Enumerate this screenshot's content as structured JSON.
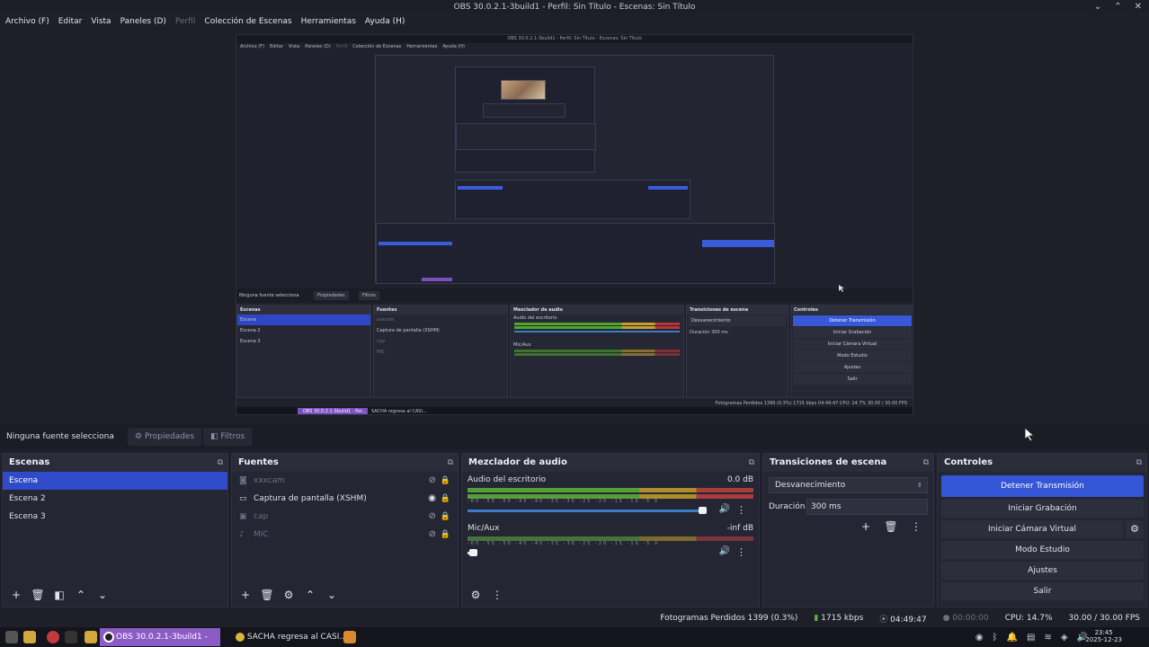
{
  "window": {
    "title": "OBS 30.0.2.1-3build1 - Perfil: Sin Título - Escenas: Sin Título",
    "controls": [
      "⌄",
      "⌃",
      "✕"
    ]
  },
  "menu": [
    "Archivo (F)",
    "Editar",
    "Vista",
    "Paneles (D)",
    "Perfil",
    "Colección de Escenas",
    "Herramientas",
    "Ayuda (H)"
  ],
  "preview": {
    "nested_title": "OBS 30.0.2.1-3build1 - Perfil: Sin Título - Escenas: Sin Título",
    "nested_menu": [
      "Archivo (F)",
      "Editar",
      "Vista",
      "Paneles (D)",
      "Perfil",
      "Colección de Escenas",
      "Herramientas",
      "Ayuda (H)"
    ],
    "nested_source_label": "Ninguna fuente selecciona",
    "nested_tabs": [
      "Propiedades",
      "Filtros"
    ],
    "nested_heads": [
      "Escenas",
      "Fuentes",
      "Mezclador de audio",
      "Transiciones de escena",
      "Controles"
    ],
    "nested_scenes": [
      "Escena",
      "Escena 2",
      "Escena 3"
    ],
    "nested_sources": [
      "xxxcam",
      "Captura de pantalla (XSHM)",
      "cap",
      "MIC"
    ],
    "nested_audio": [
      "Audio del escritorio",
      "Mic/Aux"
    ],
    "nested_trans": [
      "Desvanecimiento",
      "Duración",
      "300 ms"
    ],
    "nested_controls": [
      "Detener Transmisión",
      "Iniciar Grabación",
      "Iniciar Cámara Virtual",
      "Modo Estudio",
      "Ajustes",
      "Salir"
    ],
    "nested_status": "Fotogramas Perdidos 1399 (0.3%)   1715 kbps   04:49:47   CPU: 14.7%   30.00 / 30.00 FPS",
    "nested_task": [
      "OBS 30.0.2.1-3build1 - Per...",
      "SACHA regresa al CASI..."
    ]
  },
  "source_toolbar": {
    "label": "Ninguna fuente selecciona",
    "properties": "Propiedades",
    "filters": "Filtros"
  },
  "docks": {
    "scenes": {
      "title": "Escenas",
      "items": [
        "Escena",
        "Escena 2",
        "Escena 3"
      ],
      "selected": 0
    },
    "sources": {
      "title": "Fuentes",
      "items": [
        {
          "name": "xxxcam",
          "icon": "camera-icon",
          "visible": false
        },
        {
          "name": "Captura de pantalla (XSHM)",
          "icon": "monitor-icon",
          "visible": true
        },
        {
          "name": "cap",
          "icon": "window-icon",
          "visible": false
        },
        {
          "name": "MIC",
          "icon": "mic-icon",
          "visible": false
        }
      ]
    },
    "mixer": {
      "title": "Mezclador de audio",
      "channels": [
        {
          "name": "Audio del escritorio",
          "db": "0.0 dB",
          "volume_pct": 100
        },
        {
          "name": "Mic/Aux",
          "db": "-inf dB",
          "volume_pct": 0
        }
      ],
      "ticks": "-60 -55 -50 -45 -40 -35 -30 -25 -20 -15 -10 -5 0"
    },
    "transitions": {
      "title": "Transiciones de escena",
      "selected": "Desvanecimiento",
      "duration_label": "Duración",
      "duration_value": "300 ms"
    },
    "controls": {
      "title": "Controles",
      "stop_stream": "Detener Transmisión",
      "start_recording": "Iniciar Grabación",
      "start_vcam": "Iniciar Cámara Virtual",
      "studio_mode": "Modo Estudio",
      "settings": "Ajustes",
      "exit": "Salir"
    }
  },
  "status": {
    "dropped": "Fotogramas Perdidos 1399 (0.3%)",
    "bitrate": "1715 kbps",
    "stream_time": "04:49:47",
    "rec_time": "00:00:00",
    "cpu": "CPU: 14.7%",
    "fps": "30.00 / 30.00 FPS"
  },
  "taskbar": {
    "obs_window": "OBS 30.0.2.1-3build1 - Per...",
    "browser_window": "SACHA regresa al CASI...",
    "time": "23:45",
    "date": "2025-12-23"
  },
  "colors": {
    "accent": "#3355d6",
    "selection": "#2f4bc9",
    "bg": "#1e1f29",
    "panel": "#242633",
    "meter_green": "#5fb33a",
    "taskbar_pill": "#8b5cc6"
  }
}
